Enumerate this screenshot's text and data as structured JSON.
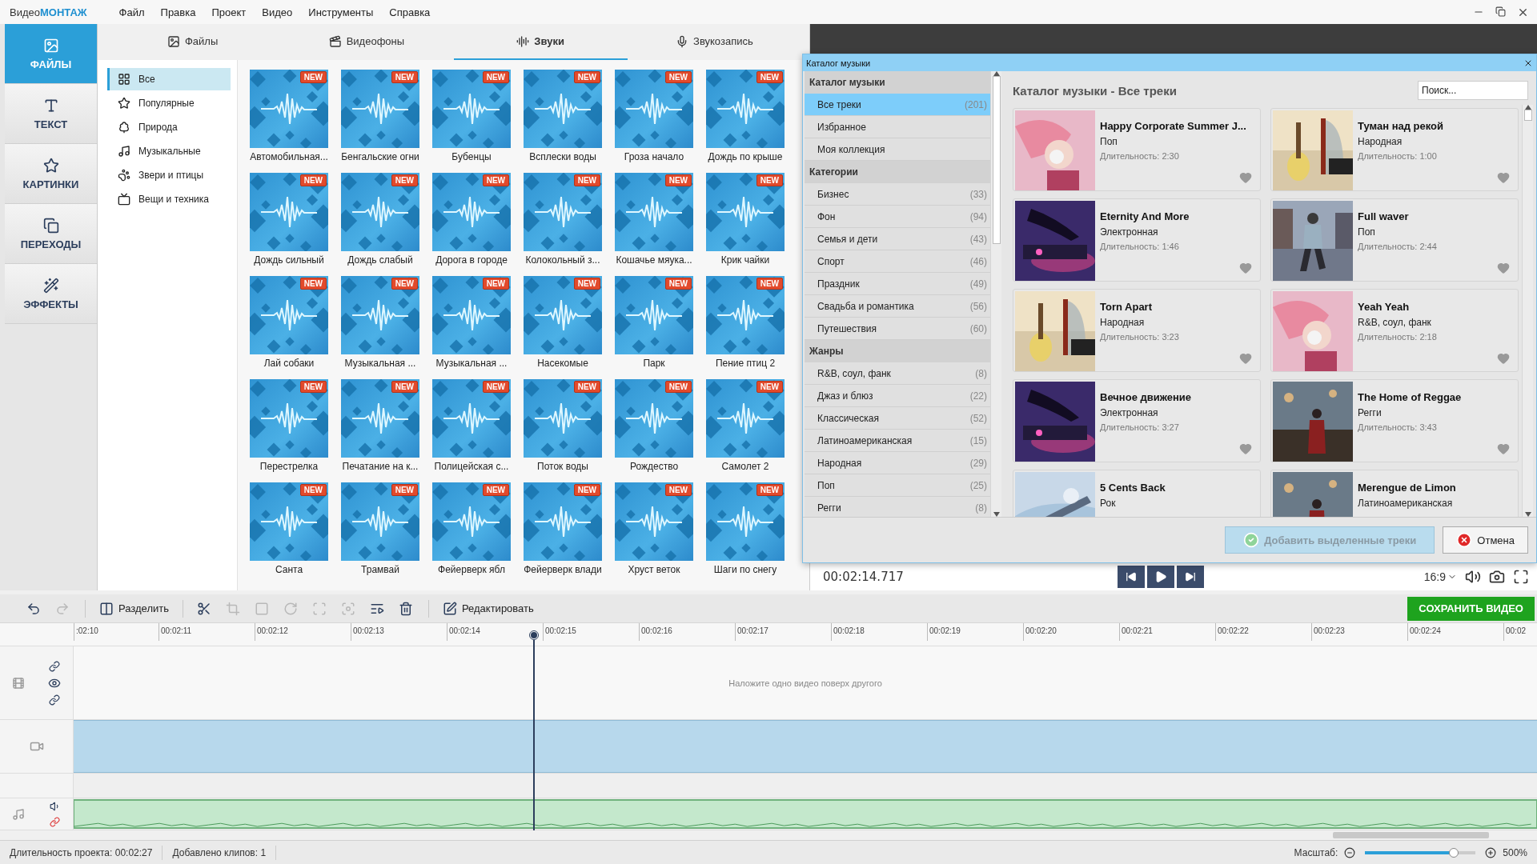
{
  "app": {
    "logo_plain": "Видео",
    "logo_accent": "МОНТАЖ"
  },
  "menu": [
    "Файл",
    "Правка",
    "Проект",
    "Видео",
    "Инструменты",
    "Справка"
  ],
  "sidebar": [
    {
      "label": "ФАЙЛЫ",
      "selected": true
    },
    {
      "label": "ТЕКСТ",
      "selected": false
    },
    {
      "label": "КАРТИНКИ",
      "selected": false
    },
    {
      "label": "ПЕРЕХОДЫ",
      "selected": false
    },
    {
      "label": "ЭФФЕКТЫ",
      "selected": false
    }
  ],
  "tabs": [
    {
      "label": "Файлы",
      "selected": false
    },
    {
      "label": "Видеофоны",
      "selected": false
    },
    {
      "label": "Звуки",
      "selected": true
    },
    {
      "label": "Звукозапись",
      "selected": false
    }
  ],
  "sound_categories": [
    {
      "label": "Все",
      "selected": true
    },
    {
      "label": "Популярные",
      "selected": false
    },
    {
      "label": "Природа",
      "selected": false
    },
    {
      "label": "Музыкальные",
      "selected": false
    },
    {
      "label": "Звери и птицы",
      "selected": false
    },
    {
      "label": "Вещи и техника",
      "selected": false
    }
  ],
  "sounds": [
    {
      "label": "Автомобильная...",
      "badge": "NEW"
    },
    {
      "label": "Бенгальские огни",
      "badge": "NEW"
    },
    {
      "label": "Бубенцы",
      "badge": "NEW"
    },
    {
      "label": "Всплески воды",
      "badge": "NEW"
    },
    {
      "label": "Гроза начало",
      "badge": "NEW"
    },
    {
      "label": "Дождь по крыше",
      "badge": "NEW"
    },
    {
      "label": "Дождь сильный",
      "badge": "NEW"
    },
    {
      "label": "Дождь слабый",
      "badge": "NEW"
    },
    {
      "label": "Дорога в городе",
      "badge": "NEW"
    },
    {
      "label": "Колокольный з...",
      "badge": "NEW"
    },
    {
      "label": "Кошачье мяука...",
      "badge": "NEW"
    },
    {
      "label": "Крик чайки",
      "badge": "NEW"
    },
    {
      "label": "Лай собаки",
      "badge": "NEW"
    },
    {
      "label": "Музыкальная ...",
      "badge": "NEW"
    },
    {
      "label": "Музыкальная ...",
      "badge": "NEW"
    },
    {
      "label": "Насекомые",
      "badge": "NEW"
    },
    {
      "label": "Парк",
      "badge": "NEW"
    },
    {
      "label": "Пение птиц 2",
      "badge": "NEW"
    },
    {
      "label": "Перестрелка",
      "badge": "NEW"
    },
    {
      "label": "Печатание на к...",
      "badge": "NEW"
    },
    {
      "label": "Полицейская с...",
      "badge": "NEW"
    },
    {
      "label": "Поток воды",
      "badge": "NEW"
    },
    {
      "label": "Рождество",
      "badge": "NEW"
    },
    {
      "label": "Самолет 2",
      "badge": "NEW"
    },
    {
      "label": "Санта",
      "badge": "NEW"
    },
    {
      "label": "Трамвай",
      "badge": "NEW"
    },
    {
      "label": "Фейерверк ябл",
      "badge": "NEW"
    },
    {
      "label": "Фейерверк влади",
      "badge": "NEW"
    },
    {
      "label": "Хруст веток",
      "badge": "NEW"
    },
    {
      "label": "Шаги по снегу",
      "badge": "NEW"
    }
  ],
  "catalog": {
    "title": "Каталог музыки",
    "heading": "Каталог музыки - Все треки",
    "search": {
      "placeholder": "Поиск..."
    },
    "sections": [
      {
        "title": "Каталог музыки",
        "items": [
          {
            "label": "Все треки",
            "count": "(201)",
            "selected": true
          },
          {
            "label": "Избранное",
            "selected": false
          },
          {
            "label": "Моя коллекция",
            "selected": false
          }
        ]
      },
      {
        "title": "Категории",
        "items": [
          {
            "label": "Бизнес",
            "count": "(33)",
            "selected": false
          },
          {
            "label": "Фон",
            "count": "(94)",
            "selected": false
          },
          {
            "label": "Семья и дети",
            "count": "(43)",
            "selected": false
          },
          {
            "label": "Спорт",
            "count": "(46)",
            "selected": false
          },
          {
            "label": "Праздник",
            "count": "(49)",
            "selected": false
          },
          {
            "label": "Свадьба и романтика",
            "count": "(56)",
            "selected": false
          },
          {
            "label": "Путешествия",
            "count": "(60)",
            "selected": false
          }
        ]
      },
      {
        "title": "Жанры",
        "items": [
          {
            "label": "R&B, соул, фанк",
            "count": "(8)",
            "selected": false
          },
          {
            "label": "Джаз и блюз",
            "count": "(22)",
            "selected": false
          },
          {
            "label": "Классическая",
            "count": "(52)",
            "selected": false
          },
          {
            "label": "Латиноамериканская",
            "count": "(15)",
            "selected": false
          },
          {
            "label": "Народная",
            "count": "(29)",
            "selected": false
          },
          {
            "label": "Поп",
            "count": "(25)",
            "selected": false
          },
          {
            "label": "Регги",
            "count": "(8)",
            "selected": false
          }
        ]
      }
    ],
    "tracks": [
      {
        "title": "Happy Corporate Summer J...",
        "genre": "Поп",
        "duration": "Длительность: 2:30"
      },
      {
        "title": "Туман над рекой",
        "genre": "Народная",
        "duration": "Длительность: 1:00"
      },
      {
        "title": "Eternity And More",
        "genre": "Электронная",
        "duration": "Длительность: 1:46"
      },
      {
        "title": "Full waver",
        "genre": "Поп",
        "duration": "Длительность: 2:44"
      },
      {
        "title": "Torn Apart",
        "genre": "Народная",
        "duration": "Длительность: 3:23"
      },
      {
        "title": "Yeah Yeah",
        "genre": "R&B, соул, фанк",
        "duration": "Длительность: 2:18"
      },
      {
        "title": "Вечное движение",
        "genre": "Электронная",
        "duration": "Длительность: 3:27"
      },
      {
        "title": "The Home of Reggae",
        "genre": "Регги",
        "duration": "Длительность: 3:43"
      },
      {
        "title": "5 Cents Back",
        "genre": "Рок"
      },
      {
        "title": "Merengue de Limon",
        "genre": "Латиноамериканская"
      }
    ],
    "add_button": {
      "label": "Добавить выделенные треки",
      "disabled": true
    },
    "cancel_button": "Отмена"
  },
  "player": {
    "time": "00:02:14.717",
    "aspect": "16:9"
  },
  "tools": [
    {
      "kind": "undo",
      "disabled": false
    },
    {
      "kind": "redo",
      "disabled": true
    },
    {
      "kind": "split",
      "label": "Разделить",
      "disabled": false
    },
    {
      "kind": "cut",
      "disabled": false
    },
    {
      "kind": "crop",
      "disabled": true
    },
    {
      "kind": "frame",
      "disabled": true
    },
    {
      "kind": "rotate",
      "disabled": true
    },
    {
      "kind": "stabilize",
      "disabled": true
    },
    {
      "kind": "focus",
      "disabled": true
    },
    {
      "kind": "clip",
      "disabled": false
    },
    {
      "kind": "delete",
      "disabled": false
    },
    {
      "kind": "edit",
      "label": "Редактировать",
      "disabled": false
    }
  ],
  "save_button": "СОХРАНИТЬ ВИДЕО",
  "timeline": {
    "ruler": [
      ":02:10",
      "00:02:11",
      "00:02:12",
      "00:02:13",
      "00:02:14",
      "00:02:15",
      "00:02:16",
      "00:02:17",
      "00:02:18",
      "00:02:19",
      "00:02:20",
      "00:02:21",
      "00:02:22",
      "00:02:23",
      "00:02:24",
      "00:02"
    ],
    "overlay_hint": "Наложите одно видео поверх другого"
  },
  "status": {
    "duration_label": "Длительность проекта:",
    "duration": "00:02:27",
    "clips": "Добавлено клипов: 1",
    "zoom_label": "Масштаб:",
    "zoom": {
      "level": 0.8
    },
    "zoom_value": "500%"
  }
}
